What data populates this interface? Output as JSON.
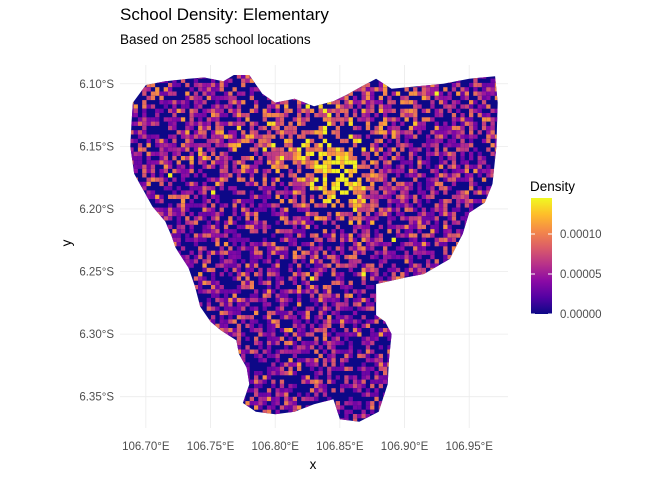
{
  "title": "School Density: Elementary",
  "subtitle": "Based on 2585 school locations",
  "chart_data": {
    "type": "heatmap",
    "title": "School Density: Elementary",
    "subtitle": "Based on 2585 school locations",
    "xlabel": "x",
    "ylabel": "y",
    "x_ticks": [
      106.7,
      106.75,
      106.8,
      106.85,
      106.9,
      106.95
    ],
    "x_tick_labels": [
      "106.70°E",
      "106.75°E",
      "106.80°E",
      "106.85°E",
      "106.90°E",
      "106.95°E"
    ],
    "y_ticks": [
      -6.1,
      -6.15,
      -6.2,
      -6.25,
      -6.3,
      -6.35
    ],
    "y_tick_labels": [
      "6.10°S",
      "6.15°S",
      "6.20°S",
      "6.25°S",
      "6.30°S",
      "6.35°S"
    ],
    "xlim": [
      106.68,
      106.98
    ],
    "ylim": [
      -6.375,
      -6.085
    ],
    "grid": true,
    "legend": {
      "title": "Density",
      "position": "right",
      "range": [
        0,
        0.000145
      ],
      "breaks": [
        0,
        5e-05,
        0.0001
      ],
      "labels": [
        "0.00000",
        "0.00005",
        "0.00010"
      ],
      "colormap": "plasma",
      "colors": [
        "#0d0887",
        "#5302a3",
        "#8b0aa5",
        "#b83289",
        "#db5c68",
        "#f48849",
        "#febd2a",
        "#f0f921"
      ]
    },
    "region_outline_lonlat": [
      [
        106.69,
        -6.115
      ],
      [
        106.7,
        -6.101
      ],
      [
        106.715,
        -6.098
      ],
      [
        106.733,
        -6.096
      ],
      [
        106.745,
        -6.095
      ],
      [
        106.76,
        -6.098
      ],
      [
        106.768,
        -6.093
      ],
      [
        106.78,
        -6.093
      ],
      [
        106.79,
        -6.108
      ],
      [
        106.8,
        -6.115
      ],
      [
        106.815,
        -6.112
      ],
      [
        106.83,
        -6.118
      ],
      [
        106.845,
        -6.114
      ],
      [
        106.855,
        -6.109
      ],
      [
        106.867,
        -6.102
      ],
      [
        106.878,
        -6.096
      ],
      [
        106.89,
        -6.104
      ],
      [
        106.91,
        -6.102
      ],
      [
        106.93,
        -6.1
      ],
      [
        106.95,
        -6.096
      ],
      [
        106.97,
        -6.094
      ],
      [
        106.972,
        -6.115
      ],
      [
        106.971,
        -6.15
      ],
      [
        106.968,
        -6.18
      ],
      [
        106.962,
        -6.195
      ],
      [
        106.95,
        -6.203
      ],
      [
        106.945,
        -6.22
      ],
      [
        106.935,
        -6.24
      ],
      [
        106.915,
        -6.252
      ],
      [
        106.9,
        -6.255
      ],
      [
        106.878,
        -6.26
      ],
      [
        106.878,
        -6.285
      ],
      [
        106.885,
        -6.29
      ],
      [
        106.89,
        -6.3
      ],
      [
        106.888,
        -6.32
      ],
      [
        106.887,
        -6.34
      ],
      [
        106.88,
        -6.362
      ],
      [
        106.865,
        -6.37
      ],
      [
        106.85,
        -6.368
      ],
      [
        106.845,
        -6.352
      ],
      [
        106.83,
        -6.356
      ],
      [
        106.815,
        -6.362
      ],
      [
        106.8,
        -6.364
      ],
      [
        106.785,
        -6.362
      ],
      [
        106.775,
        -6.355
      ],
      [
        106.78,
        -6.34
      ],
      [
        106.778,
        -6.327
      ],
      [
        106.772,
        -6.316
      ],
      [
        106.77,
        -6.305
      ],
      [
        106.758,
        -6.297
      ],
      [
        106.75,
        -6.29
      ],
      [
        106.742,
        -6.278
      ],
      [
        106.738,
        -6.262
      ],
      [
        106.733,
        -6.247
      ],
      [
        106.723,
        -6.231
      ],
      [
        106.72,
        -6.222
      ],
      [
        106.715,
        -6.21
      ],
      [
        106.705,
        -6.198
      ],
      [
        106.697,
        -6.183
      ],
      [
        106.691,
        -6.172
      ],
      [
        106.688,
        -6.15
      ],
      [
        106.689,
        -6.13
      ]
    ]
  }
}
